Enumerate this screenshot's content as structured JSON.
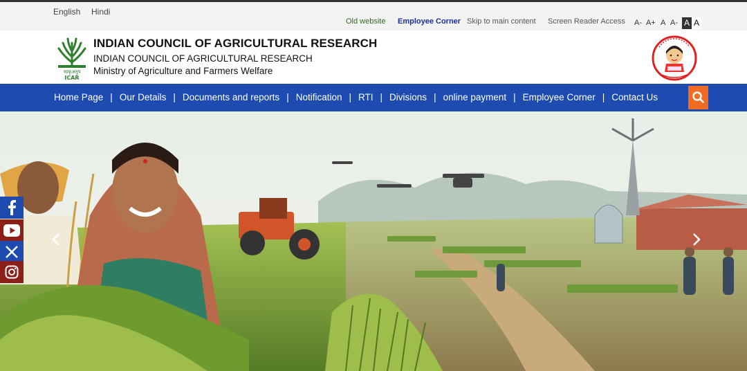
{
  "utility": {
    "languages": [
      "English",
      "Hindi"
    ],
    "links": {
      "old_website": "Old website",
      "employee_corner": "Employee Corner",
      "skip": "Skip to main content",
      "screen_reader": "Screen Reader Access"
    },
    "font_sizes": [
      "A-",
      "A+",
      "A",
      "A-"
    ],
    "contrast": [
      "A",
      "A"
    ]
  },
  "header": {
    "title": "INDIAN COUNCIL OF AGRICULTURAL RESEARCH",
    "subtitle": "INDIAN COUNCIL OF AGRICULTURAL RESEARCH",
    "ministry": "Ministry of Agriculture and Farmers Welfare",
    "logo_text": "ICAR"
  },
  "nav": {
    "items": [
      {
        "label": "Home Page"
      },
      {
        "label": "Our Details"
      },
      {
        "label": "Documents and reports"
      },
      {
        "label": "Notification"
      },
      {
        "label": "RTI"
      },
      {
        "label": "Divisions"
      },
      {
        "label": "online payment"
      },
      {
        "label": "Employee Corner"
      },
      {
        "label": "Contact Us"
      }
    ],
    "separator": "|",
    "search_icon": "search-icon"
  },
  "hero": {
    "prev_icon": "chevron-left-icon",
    "next_icon": "chevron-right-icon"
  },
  "social": {
    "icons": [
      "facebook-icon",
      "youtube-icon",
      "x-icon",
      "instagram-icon"
    ]
  },
  "colors": {
    "nav_bg": "#1e4bb0",
    "search_bg": "#f26b22",
    "social_red": "#8c1f18",
    "icar_green": "#2f7f2f"
  }
}
